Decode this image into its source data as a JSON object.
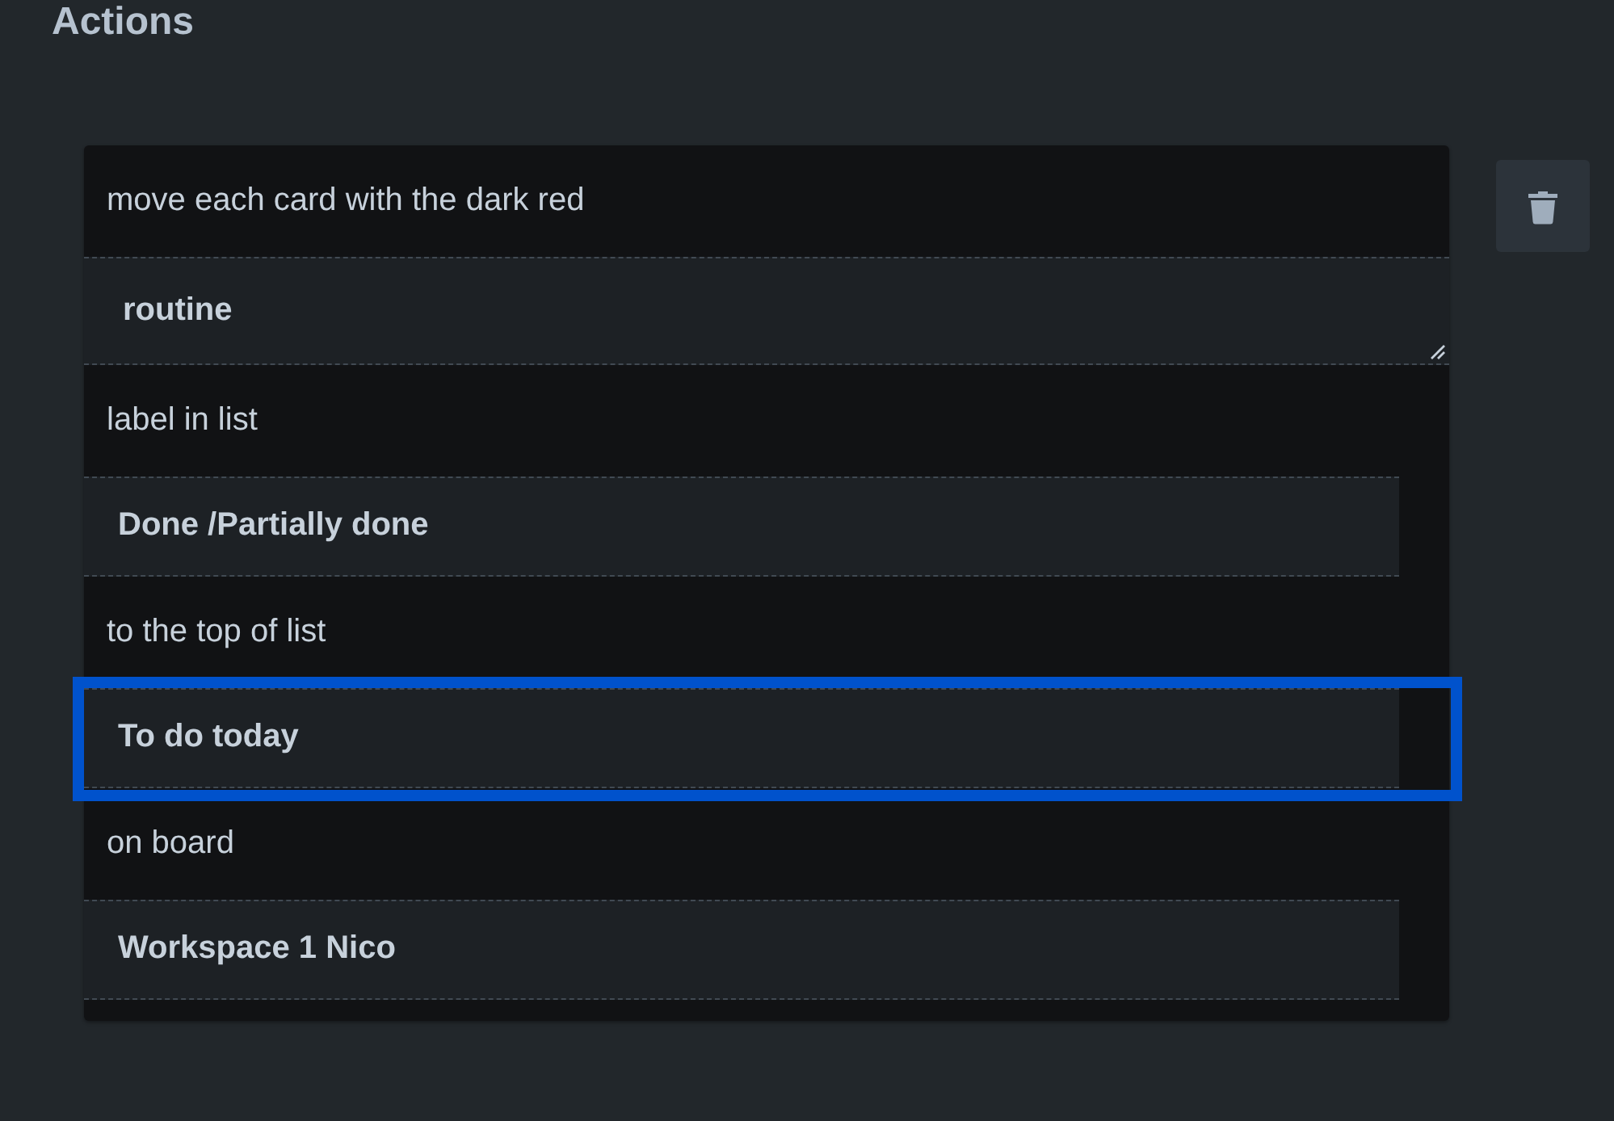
{
  "section": {
    "title": "Actions"
  },
  "action": {
    "parts": [
      {
        "kind": "text",
        "text": "move each card with the dark red"
      },
      {
        "kind": "textarea",
        "value": "routine",
        "highlighted": false
      },
      {
        "kind": "text",
        "text": "label in list"
      },
      {
        "kind": "field",
        "value": "Done /Partially done",
        "highlighted": false
      },
      {
        "kind": "text",
        "text": "to the top of list"
      },
      {
        "kind": "field",
        "value": "To do today",
        "highlighted": true
      },
      {
        "kind": "text",
        "text": "on board"
      },
      {
        "kind": "field",
        "value": "Workspace 1 Nico",
        "highlighted": false
      }
    ]
  }
}
